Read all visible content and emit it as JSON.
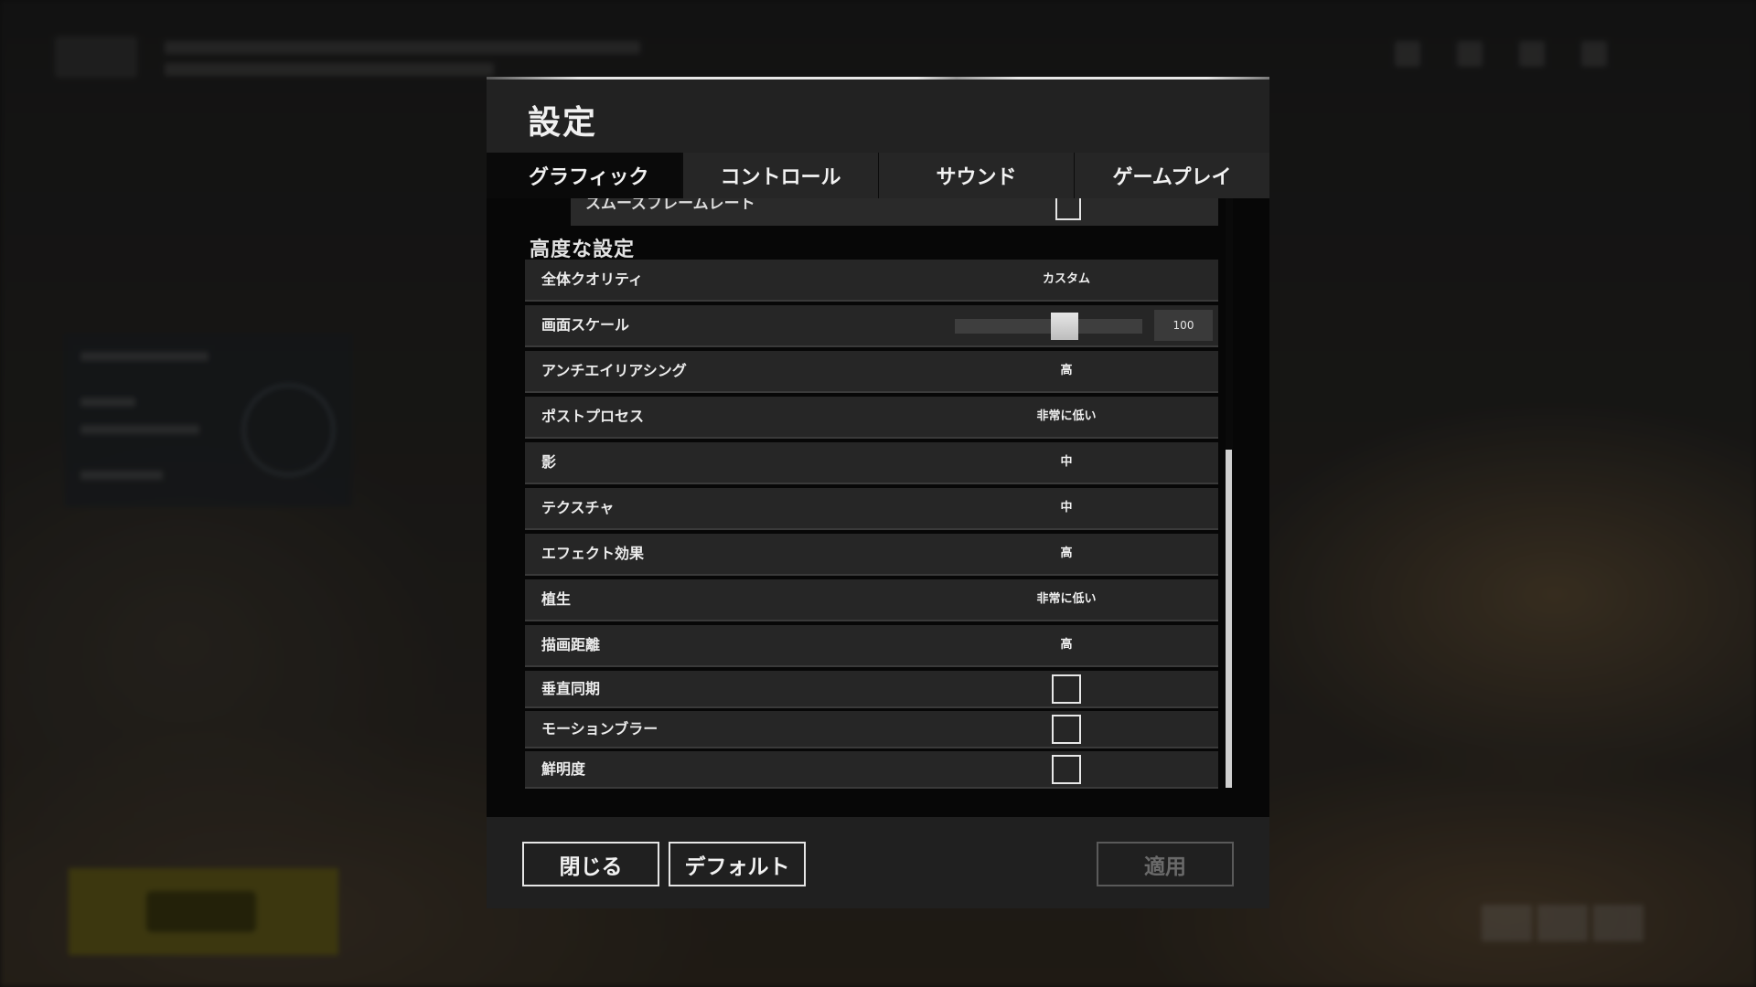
{
  "dialog": {
    "title": "設定"
  },
  "tabs": [
    {
      "label": "グラフィック",
      "active": true
    },
    {
      "label": "コントロール",
      "active": false
    },
    {
      "label": "サウンド",
      "active": false
    },
    {
      "label": "ゲームプレイ",
      "active": false
    }
  ],
  "partial_row": {
    "label": "スムーズフレームレート",
    "checked": false
  },
  "section_title": "高度な設定",
  "settings": {
    "overall_quality": {
      "label": "全体クオリティ",
      "value": "カスタム"
    },
    "screen_scale": {
      "label": "画面スケール",
      "value": "100",
      "slider_fraction": 0.6
    },
    "anti_aliasing": {
      "label": "アンチエイリアシング",
      "value": "高"
    },
    "post_process": {
      "label": "ポストプロセス",
      "value": "非常に低い"
    },
    "shadows": {
      "label": "影",
      "value": "中"
    },
    "textures": {
      "label": "テクスチャ",
      "value": "中"
    },
    "effects": {
      "label": "エフェクト効果",
      "value": "高"
    },
    "foliage": {
      "label": "植生",
      "value": "非常に低い"
    },
    "view_distance": {
      "label": "描画距離",
      "value": "高"
    },
    "vsync": {
      "label": "垂直同期",
      "checked": false
    },
    "motion_blur": {
      "label": "モーションブラー",
      "checked": false
    },
    "sharpness": {
      "label": "鮮明度",
      "checked": false
    }
  },
  "footer": {
    "close_label": "閉じる",
    "default_label": "デフォルト",
    "apply_label": "適用"
  },
  "colors": {
    "panel": "#222222",
    "content": "#070707",
    "row": "#262626",
    "text": "#ececec"
  }
}
